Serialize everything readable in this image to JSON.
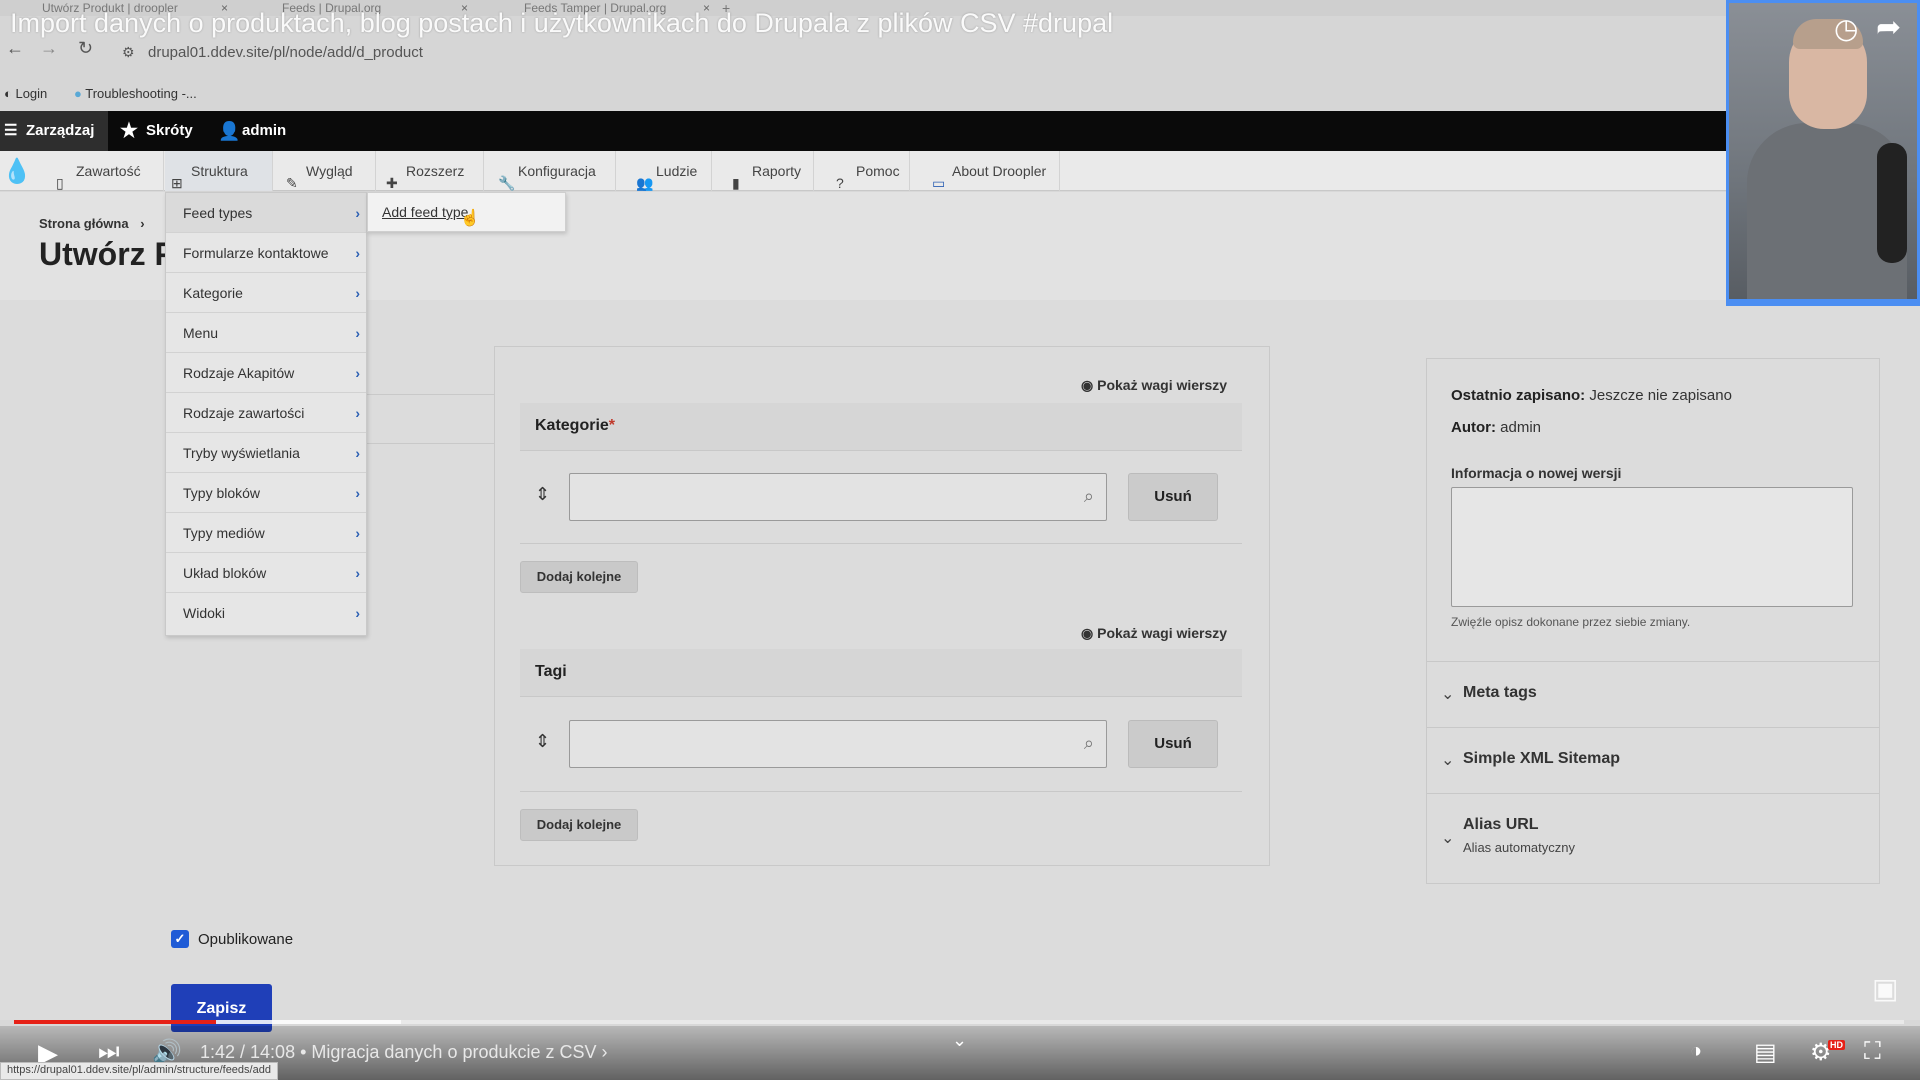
{
  "video": {
    "title": "Import danych o produktach, blog postach i użytkownikach do Drupala z plików CSV #drupal",
    "time": "1:42 / 14:08 • Migracja danych o produkcie z CSV ›",
    "played_fraction": 0.107,
    "buffered_fraction": 0.205,
    "hd_label": "HD",
    "accent_color": "#e62117"
  },
  "browser": {
    "tabs": [
      {
        "label": "Utwórz Produkt | droopler"
      },
      {
        "label": "Feeds | Drupal.org"
      },
      {
        "label": "Feeds Tamper | Drupal.org"
      }
    ],
    "tab_close": "×",
    "new_tab": "+",
    "url": "drupal01.ddev.site/pl/node/add/d_product",
    "bookmarks": [
      "Login",
      "Troubleshooting -..."
    ],
    "status_url": "https://drupal01.ddev.site/pl/admin/structure/feeds/add"
  },
  "admin_bar": {
    "manage": "Zarządzaj",
    "shortcuts": "Skróty",
    "user": "admin"
  },
  "admin_tray": {
    "items": [
      {
        "label": "Zawartość",
        "icon": "file-icon"
      },
      {
        "label": "Struktura",
        "icon": "sitemap-icon"
      },
      {
        "label": "Wygląd",
        "icon": "brush-icon"
      },
      {
        "label": "Rozszerz",
        "icon": "puzzle-icon"
      },
      {
        "label": "Konfiguracja",
        "icon": "wrench-icon"
      },
      {
        "label": "Ludzie",
        "icon": "people-icon"
      },
      {
        "label": "Raporty",
        "icon": "chart-icon"
      },
      {
        "label": "Pomoc",
        "icon": "help-icon"
      },
      {
        "label": "About Droopler",
        "icon": "droplet-icon"
      }
    ]
  },
  "page": {
    "breadcrumb": "Strona główna",
    "breadcrumb_sep": "›",
    "title": "Utwórz Produkt"
  },
  "structure_menu": {
    "items": [
      "Feed types",
      "Formularze kontaktowe",
      "Kategorie",
      "Menu",
      "Rodzaje Akapitów",
      "Rodzaje zawartości",
      "Tryby wyświetlania",
      "Typy bloków",
      "Typy mediów",
      "Układ bloków",
      "Widoki"
    ],
    "submenu": "Add feed type",
    "chevron": "›"
  },
  "form": {
    "show_weights": "Pokaż wagi wierszy",
    "fields": [
      {
        "label": "Kategorie",
        "required": true
      },
      {
        "label": "Tagi",
        "required": false
      }
    ],
    "required_mark": "*",
    "remove_label": "Usuń",
    "add_more_label": "Dodaj kolejne",
    "published_label": "Opublikowane",
    "save_label": "Zapisz"
  },
  "sidebar": {
    "last_saved_label": "Ostatnio zapisano:",
    "last_saved_value": "Jeszcze nie zapisano",
    "author_label": "Autor:",
    "author_value": "admin",
    "revision_label": "Informacja o nowej wersji",
    "revision_hint": "Zwięźle opisz dokonane przez siebie zmiany.",
    "sections": [
      {
        "title": "Meta tags",
        "subtitle": ""
      },
      {
        "title": "Simple XML Sitemap",
        "subtitle": ""
      },
      {
        "title": "Alias URL",
        "subtitle": "Alias automatyczny"
      }
    ]
  },
  "colors": {
    "primary_button": "#1f3fb8",
    "required": "#c0392b",
    "webcam_border": "#4b8ef2"
  }
}
